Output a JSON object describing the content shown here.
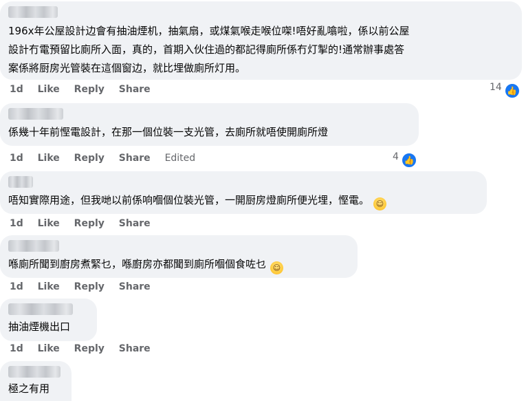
{
  "comments": [
    {
      "lines": [
        "196x年公屋設計边會有抽油煙机，抽氣扇，或煤氣喉走喉位㗎!唔好亂噏啦，係以前公屋",
        "設計冇電預留比廁所入面，真的，首期入伙住過的都記得廁所係冇灯掣的!通常辦事處答",
        "案係將厨房光管裝在這個窗边，就比埋做廁所灯用。"
      ],
      "time": "1d",
      "like": "Like",
      "reply": "Reply",
      "share": "Share",
      "reaction_count": "14"
    },
    {
      "lines": [
        "係幾十年前慳電設計，在那一個位裝一支光管，去廁所就唔使開廁所燈"
      ],
      "time": "1d",
      "like": "Like",
      "reply": "Reply",
      "share": "Share",
      "edited": "Edited",
      "reaction_count": "4"
    },
    {
      "lines": [
        "唔知實際用途，但我哋以前係响嗰個位裝光管，一開厨房燈廁所便光埋，慳電。"
      ],
      "emoji": "sweat-smile-emoji",
      "time": "1d",
      "like": "Like",
      "reply": "Reply",
      "share": "Share"
    },
    {
      "lines": [
        "喺廁所聞到廚房煮緊乜，喺廚房亦都聞到廁所嗰個食咗乜"
      ],
      "emoji": "tongue-out-emoji",
      "time": "1d",
      "like": "Like",
      "reply": "Reply",
      "share": "Share"
    },
    {
      "lines": [
        "抽油煙機出口"
      ],
      "time": "1d",
      "like": "Like",
      "reply": "Reply",
      "share": "Share"
    },
    {
      "lines": [
        "極之有用"
      ]
    }
  ],
  "icons": {
    "like": "thumbs-up-icon"
  },
  "colors": {
    "bubble": "#f0f2f5",
    "meta": "#65676b",
    "like_blue": "#1877f2"
  }
}
